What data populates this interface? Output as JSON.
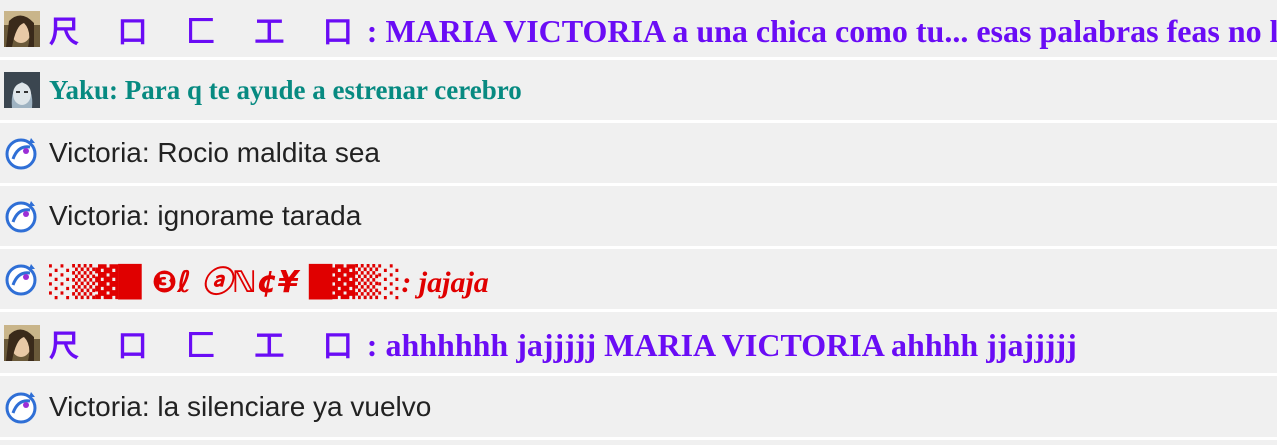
{
  "messages": [
    {
      "avatar_icon": "woman-photo-avatar",
      "nick": "尺 口 匚 工 口",
      "text": ": MARIA VICTORIA a una chica como tu... esas palabras feas no le van"
    },
    {
      "avatar_icon": "girl-photo-avatar",
      "nick": "Yaku",
      "text": ": Para q te ayude a estrenar cerebro"
    },
    {
      "avatar_icon": "default-bird-avatar",
      "nick": "Victoria",
      "text": ": Rocio maldita sea"
    },
    {
      "avatar_icon": "default-bird-avatar",
      "nick": "Victoria",
      "text": ": ignorame tarada"
    },
    {
      "avatar_icon": "default-bird-avatar",
      "nick": "░▒▓█ ❸ℓ ⓐℕ¢¥ █▓▒░",
      "text": ": jajaja"
    },
    {
      "avatar_icon": "woman-photo-avatar",
      "nick": "尺 口 匚 工 口",
      "text": ": ahhhhhh jajjjjj MARIA VICTORIA ahhhh jjajjjjj"
    },
    {
      "avatar_icon": "default-bird-avatar",
      "nick": "Victoria",
      "text": ": la silenciare ya vuelvo"
    }
  ],
  "colors": {
    "purple": "#6a0cf5",
    "teal": "#078a81",
    "red": "#e00000",
    "row_bg": "#f0f0f0",
    "divider": "#ffffff"
  }
}
